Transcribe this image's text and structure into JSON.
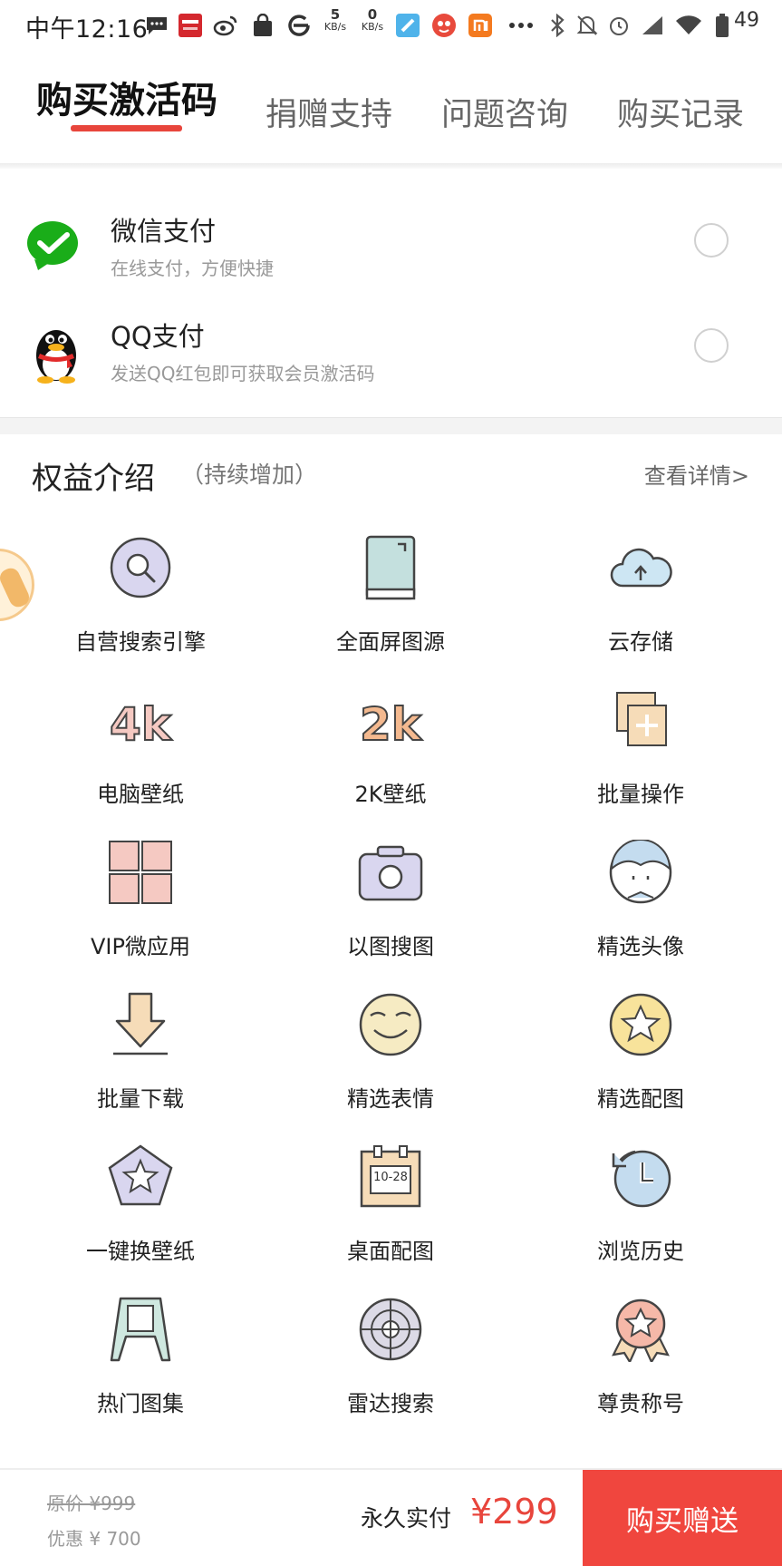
{
  "status_bar": {
    "time": "中午12:16",
    "net_up_value": "5",
    "net_up_unit": "KB/s",
    "net_down_value": "0",
    "net_down_unit": "KB/s",
    "battery": "49",
    "icons": [
      "message-icon",
      "youpin-app-icon",
      "weibo-icon",
      "bag-icon",
      "browser-icon",
      "speed-up",
      "speed-down",
      "app-blue-icon",
      "app-red-icon",
      "mi-icon",
      "more-icon",
      "bluetooth-icon",
      "mute-icon",
      "alarm-icon",
      "signal-icon",
      "wifi-icon",
      "battery-icon"
    ]
  },
  "tabs": [
    {
      "label": "购买激活码",
      "active": true
    },
    {
      "label": "捐赠支持",
      "active": false
    },
    {
      "label": "问题咨询",
      "active": false
    },
    {
      "label": "购买记录",
      "active": false
    }
  ],
  "payment_methods": [
    {
      "name": "微信支付",
      "desc": "在线支付，方便快捷",
      "icon": "wechat-icon",
      "selected": false
    },
    {
      "name": "QQ支付",
      "desc": "发送QQ红包即可获取会员激活码",
      "icon": "qq-penguin-icon",
      "selected": false
    }
  ],
  "benefits": {
    "title": "权益介绍",
    "subtitle": "（持续增加）",
    "more_link": "查看详情>",
    "items": [
      {
        "label": "自营搜索引擎",
        "icon": "search-icon"
      },
      {
        "label": "全面屏图源",
        "icon": "fullscreen-phone-icon"
      },
      {
        "label": "云存储",
        "icon": "cloud-upload-icon"
      },
      {
        "label": "电脑壁纸",
        "icon": "4k-icon"
      },
      {
        "label": "2K壁纸",
        "icon": "2k-icon"
      },
      {
        "label": "批量操作",
        "icon": "batch-add-icon"
      },
      {
        "label": "VIP微应用",
        "icon": "apps-grid-icon"
      },
      {
        "label": "以图搜图",
        "icon": "camera-icon"
      },
      {
        "label": "精选头像",
        "icon": "avatar-face-icon"
      },
      {
        "label": "批量下载",
        "icon": "download-arrow-icon"
      },
      {
        "label": "精选表情",
        "icon": "emoji-face-icon"
      },
      {
        "label": "精选配图",
        "icon": "star-badge-icon"
      },
      {
        "label": "一键换壁纸",
        "icon": "pentagon-star-icon"
      },
      {
        "label": "桌面配图",
        "icon": "calendar-icon",
        "icon_text": "10-28"
      },
      {
        "label": "浏览历史",
        "icon": "history-clock-icon"
      },
      {
        "label": "热门图集",
        "icon": "easel-icon"
      },
      {
        "label": "雷达搜索",
        "icon": "radar-icon"
      },
      {
        "label": "尊贵称号",
        "icon": "medal-icon"
      }
    ]
  },
  "pricing": {
    "original": "原价 ¥999",
    "discount": "优惠 ¥ 700",
    "final_label": "永久实付",
    "final_price": "¥299",
    "buy_button": "购买赠送"
  },
  "colors": {
    "accent_red": "#e8453c",
    "buy_button_bg": "#f0463e",
    "wechat_green": "#1aad19",
    "icon_pink": "#f5c9c2",
    "icon_lavender": "#d9d6ef",
    "icon_peach": "#f6dcb8"
  }
}
